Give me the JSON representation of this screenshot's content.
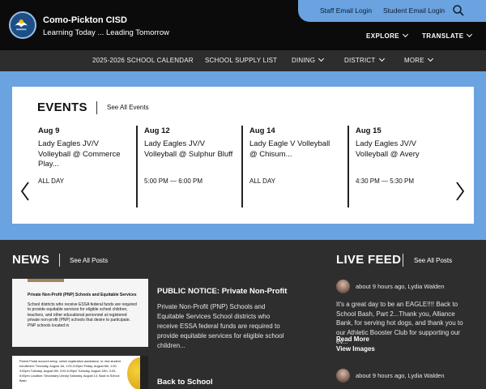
{
  "header": {
    "site_title": "Como-Pickton CISD",
    "tagline": "Learning Today ... Leading Tomorrow",
    "staff_email": "Staff Email Login",
    "student_email": "Student Email Login",
    "explore": "EXPLORE",
    "translate": "TRANSLATE"
  },
  "nav": {
    "items": [
      {
        "label": "2025-2026 SCHOOL CALENDAR"
      },
      {
        "label": "SCHOOL SUPPLY LIST"
      },
      {
        "label": "DINING"
      },
      {
        "label": "DISTRICT"
      },
      {
        "label": "MORE"
      }
    ]
  },
  "events": {
    "title": "EVENTS",
    "see_all": "See All Events",
    "items": [
      {
        "date": "Aug 9",
        "name": "Lady Eagles JV/V Volleyball @ Commerce Play...",
        "time": "ALL DAY"
      },
      {
        "date": "Aug 12",
        "name": "Lady Eagles JV/V Volleyball @ Sulphur Bluff",
        "time": "5:00 PM — 6:00 PM"
      },
      {
        "date": "Aug 14",
        "name": "Lady Eagle V Volleyball @ Chisum...",
        "time": "ALL DAY"
      },
      {
        "date": "Aug 15",
        "name": "Lady Eagles JV/V Volleyball @ Avery",
        "time": "4:30 PM — 5:30 PM"
      }
    ]
  },
  "news": {
    "title": "NEWS",
    "see_all": "See All Posts",
    "posts": [
      {
        "title": "PUBLIC NOTICE: Private Non-Profit",
        "excerpt": "Private Non-Profit (PNP) Schools and Equitable Services School districts who receive ESSA federal funds are required to provide equitable services for eligible school children...",
        "thumb_heading": "Private Non-Profit (PNP) Schools and Equitable Services",
        "thumb_text": "School districts who receive ESSA federal funds are required to provide equitable services for eligible school children, teachers, and other educational personnel at registered private non-profit (PNP) schools that desire to participate. PNP schools located in"
      },
      {
        "title": "Back to School",
        "thumb_text": "Parent Portal account setup, online registration assistance, or new student enrollment: Thursday, August 1st, 1:00-3:00pm Friday, August 8th, 1:00-3:00pm Tuesday, August 5th, 3:00-6:00pm Tuesday, August 12th, 3:00-6:00pm Location: Secondary Library Saturday, August 13, Back to School Bash"
      }
    ]
  },
  "live_feed": {
    "title": "LIVE FEED",
    "see_all": "See All Posts",
    "items": [
      {
        "meta": "about 9 hours ago, Lydia Walden",
        "body": "It's a great day to be an EAGLE!!!! Back to School Bash, Part 2...Thank you, Alliance Bank, for serving hot dogs, and thank you to our Athletic Booster Club for supporting our ev...",
        "read_more": "Read More",
        "view_images": "View Images"
      },
      {
        "meta": "about 9 hours ago, Lydia Walden"
      }
    ]
  },
  "colors": {
    "accent_blue": "#6aa3e0",
    "header_black": "#0b0b0b",
    "nav_gray": "#2d2d2d",
    "body_dark": "#2e2e2e"
  }
}
